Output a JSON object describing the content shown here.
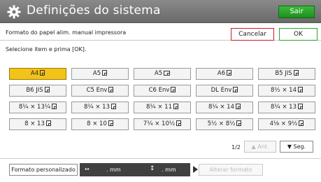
{
  "window": {
    "title": "Definições do sistema",
    "exit_label": "Sair"
  },
  "header": {
    "label": "Formato do papel alim. manual impressora",
    "cancel_label": "Cancelar",
    "ok_label": "OK"
  },
  "instruction": "Selecione item e prima [OK].",
  "paper_sizes": [
    [
      "A4",
      "A5",
      "A5",
      "A6",
      "B5 JIS"
    ],
    [
      "B6 JIS",
      "C5 Env",
      "C6 Env",
      "DL Env",
      "8½ × 14"
    ],
    [
      "8¼ × 13¼",
      "8¼ × 13",
      "8¼ × 11",
      "8¼ × 14",
      "8¼ × 13"
    ],
    [
      "8 × 13",
      "8 × 10",
      "7¼ × 10½",
      "5½ × 8½",
      "4⅛ × 9½"
    ]
  ],
  "selected_size": "A4",
  "pager": {
    "page": "1/2",
    "prev_label": "▲ Ant.",
    "next_label": "▼ Seg."
  },
  "bottom": {
    "custom_label": "Formato personalizado",
    "width_value": ". mm",
    "height_value": ". mm",
    "alter_label": "Alterar formato"
  }
}
